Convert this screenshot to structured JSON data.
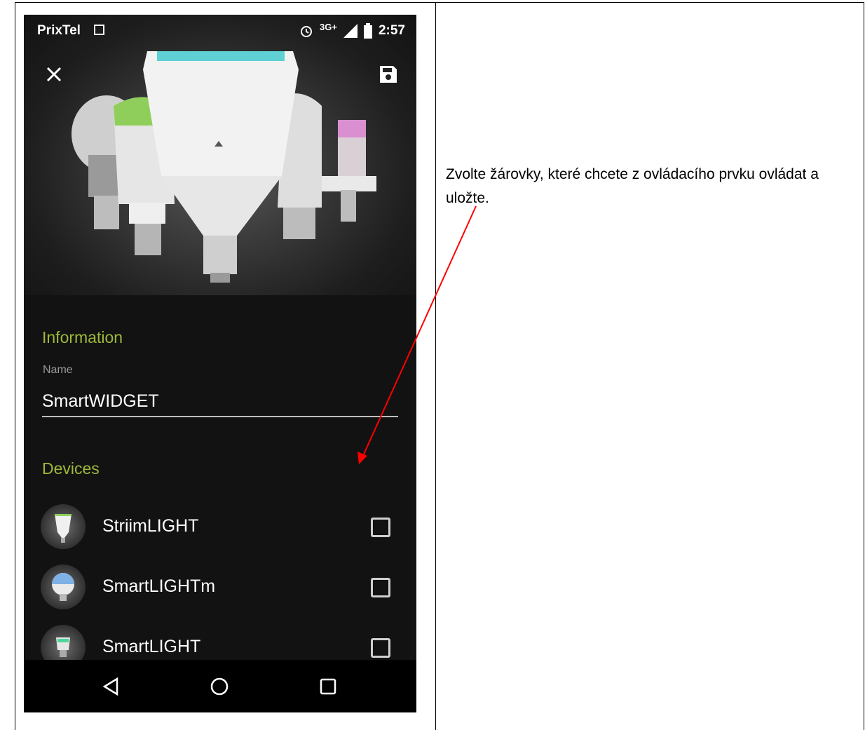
{
  "document": {
    "instruction_text": "Zvolte žárovky, které chcete z ovládacího prvku ovládat a uložte."
  },
  "status_bar": {
    "carrier": "PrixTel",
    "network": "3G+",
    "time": "2:57"
  },
  "toolbar": {
    "close_icon": "close-icon",
    "save_icon": "save-icon"
  },
  "information": {
    "section_title": "Information",
    "name_label": "Name",
    "name_value": "SmartWIDGET"
  },
  "devices": {
    "section_title": "Devices",
    "items": [
      {
        "name": "StriimLIGHT",
        "checked": false
      },
      {
        "name": "SmartLIGHTm",
        "checked": false
      },
      {
        "name": "SmartLIGHT",
        "checked": false
      }
    ]
  },
  "nav_bar": {
    "back_icon": "back-triangle-icon",
    "home_icon": "home-circle-icon",
    "recents_icon": "recents-square-icon"
  },
  "colors": {
    "accent": "#9db93a",
    "annotation": "#ff0000",
    "background": "#121212"
  }
}
